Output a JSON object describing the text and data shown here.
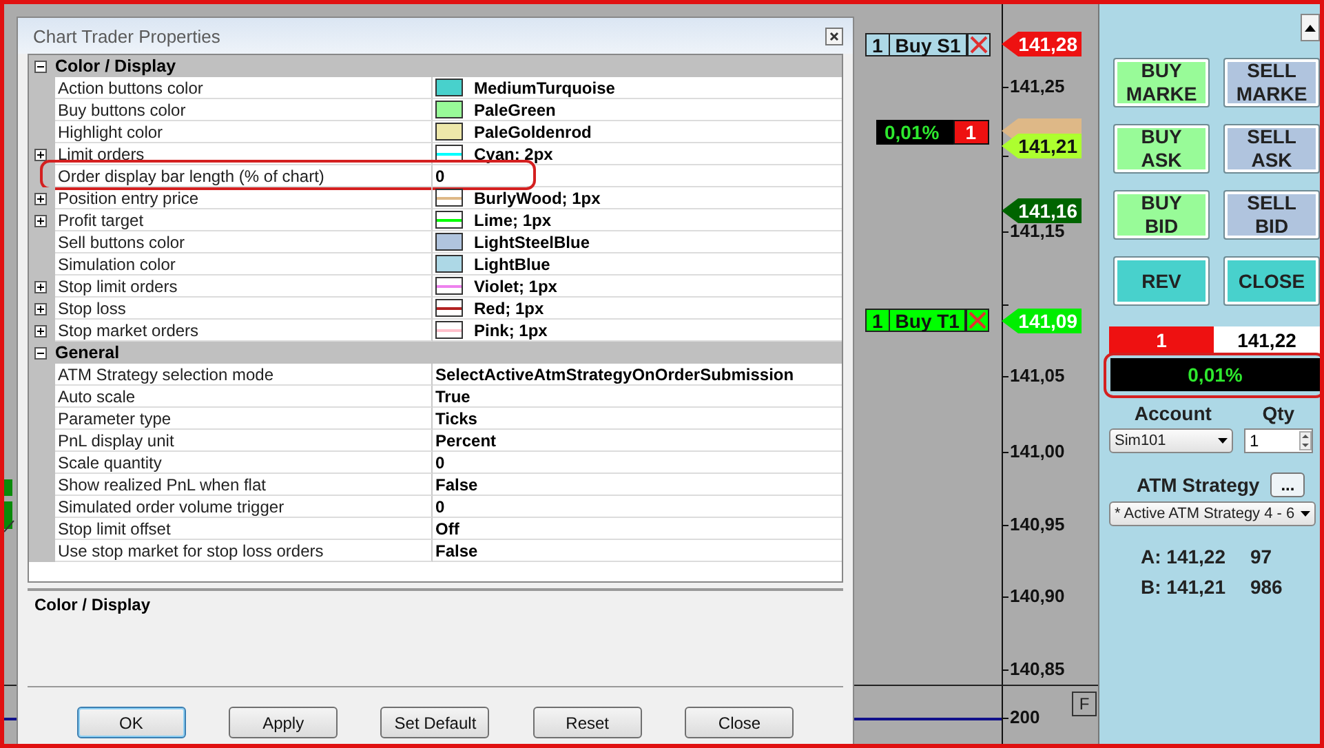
{
  "dialog": {
    "title": "Chart Trader Properties",
    "categories": [
      {
        "name": "Color / Display",
        "expanded": true,
        "properties": [
          {
            "name": "Action buttons color",
            "value": "MediumTurquoise",
            "kind": "color",
            "color": "#48d1cc",
            "expandable": false,
            "highlighted": false
          },
          {
            "name": "Buy buttons color",
            "value": "PaleGreen",
            "kind": "color",
            "color": "#98fb98",
            "expandable": false,
            "highlighted": false
          },
          {
            "name": "Highlight color",
            "value": "PaleGoldenrod",
            "kind": "color",
            "color": "#eee8aa",
            "expandable": false,
            "highlighted": false
          },
          {
            "name": "Limit orders",
            "value": "Cyan; 2px",
            "kind": "line",
            "color": "#00ffff",
            "expandable": true,
            "highlighted": false
          },
          {
            "name": "Order display bar length (% of chart)",
            "value": "0",
            "kind": "text",
            "expandable": false,
            "highlighted": true
          },
          {
            "name": "Position entry price",
            "value": "BurlyWood; 1px",
            "kind": "line",
            "color": "#deb887",
            "expandable": true,
            "highlighted": false
          },
          {
            "name": "Profit target",
            "value": "Lime; 1px",
            "kind": "line",
            "color": "#00ff00",
            "expandable": true,
            "highlighted": false
          },
          {
            "name": "Sell buttons color",
            "value": "LightSteelBlue",
            "kind": "color",
            "color": "#b0c4de",
            "expandable": false,
            "highlighted": false
          },
          {
            "name": "Simulation color",
            "value": "LightBlue",
            "kind": "color",
            "color": "#add8e6",
            "expandable": false,
            "highlighted": false
          },
          {
            "name": "Stop limit orders",
            "value": "Violet; 1px",
            "kind": "line",
            "color": "#ee82ee",
            "expandable": true,
            "highlighted": false
          },
          {
            "name": "Stop loss",
            "value": "Red; 1px",
            "kind": "line",
            "color": "#b22222",
            "expandable": true,
            "highlighted": false
          },
          {
            "name": "Stop market orders",
            "value": "Pink; 1px",
            "kind": "line",
            "color": "#ffc0cb",
            "expandable": true,
            "highlighted": false
          }
        ]
      },
      {
        "name": "General",
        "expanded": true,
        "properties": [
          {
            "name": "ATM Strategy selection mode",
            "value": "SelectActiveAtmStrategyOnOrderSubmission",
            "kind": "text",
            "expandable": false,
            "highlighted": false
          },
          {
            "name": "Auto scale",
            "value": "True",
            "kind": "text",
            "expandable": false,
            "highlighted": false
          },
          {
            "name": "Parameter type",
            "value": "Ticks",
            "kind": "text",
            "expandable": false,
            "highlighted": false
          },
          {
            "name": "PnL display unit",
            "value": "Percent",
            "kind": "text",
            "expandable": false,
            "highlighted": false
          },
          {
            "name": "Scale quantity",
            "value": "0",
            "kind": "text",
            "expandable": false,
            "highlighted": false
          },
          {
            "name": "Show realized PnL when flat",
            "value": "False",
            "kind": "text",
            "expandable": false,
            "highlighted": false
          },
          {
            "name": "Simulated order volume trigger",
            "value": "0",
            "kind": "text",
            "expandable": false,
            "highlighted": false
          },
          {
            "name": "Stop limit offset",
            "value": "Off",
            "kind": "text",
            "expandable": false,
            "highlighted": false
          },
          {
            "name": "Use stop market for stop loss orders",
            "value": "False",
            "kind": "text",
            "expandable": false,
            "highlighted": false
          }
        ]
      }
    ],
    "description": {
      "title": "Color / Display"
    },
    "buttons": [
      {
        "label": "OK",
        "default": true
      },
      {
        "label": "Apply",
        "default": false
      },
      {
        "label": "Set Default",
        "default": false
      },
      {
        "label": "Reset",
        "default": false
      },
      {
        "label": "Close",
        "default": false
      }
    ]
  },
  "chart": {
    "price_ticks": [
      "141,25",
      "141,15",
      "141,05",
      "141,00",
      "140,95",
      "140,90",
      "140,85",
      "200"
    ],
    "price_tags": [
      {
        "price": "141,28",
        "color": "#ee1111"
      },
      {
        "color": "#deb887"
      },
      {
        "price": "141,21",
        "color": "#adff2f"
      },
      {
        "price": "141,16",
        "color": "#006400"
      },
      {
        "price": "141,09",
        "color": "#00ee00"
      }
    ],
    "orders": [
      {
        "qty": "1",
        "label": "Buy S1",
        "color": "#add8e6"
      },
      {
        "qty": "1",
        "label": "Buy T1",
        "color": "#00ff00"
      }
    ],
    "pnl": {
      "value": "0,01%",
      "qty": "1"
    },
    "panel_toggle": "F"
  },
  "panel": {
    "buttons": [
      {
        "label": "BUY MARKE",
        "kind": "buy"
      },
      {
        "label": "SELL MARKE",
        "kind": "sell"
      },
      {
        "label": "BUY ASK",
        "kind": "buy"
      },
      {
        "label": "SELL ASK",
        "kind": "sell"
      },
      {
        "label": "BUY BID",
        "kind": "buy"
      },
      {
        "label": "SELL BID",
        "kind": "sell"
      },
      {
        "label": "REV",
        "kind": "action"
      },
      {
        "label": "CLOSE",
        "kind": "action"
      }
    ],
    "position": {
      "qty": "1",
      "price": "141,22"
    },
    "pnl": {
      "value": "0,01%",
      "highlighted": true
    },
    "account_label": "Account",
    "qty_label": "Qty",
    "account": "Sim101",
    "qty": "1",
    "atm_label": "ATM Strategy",
    "atm_button": "...",
    "atm_strategy": "* Active ATM Strategy 4 - 6",
    "quotes": [
      {
        "label": "A: 141,22",
        "size": "97"
      },
      {
        "label": "B: 141,21",
        "size": "986"
      }
    ]
  }
}
